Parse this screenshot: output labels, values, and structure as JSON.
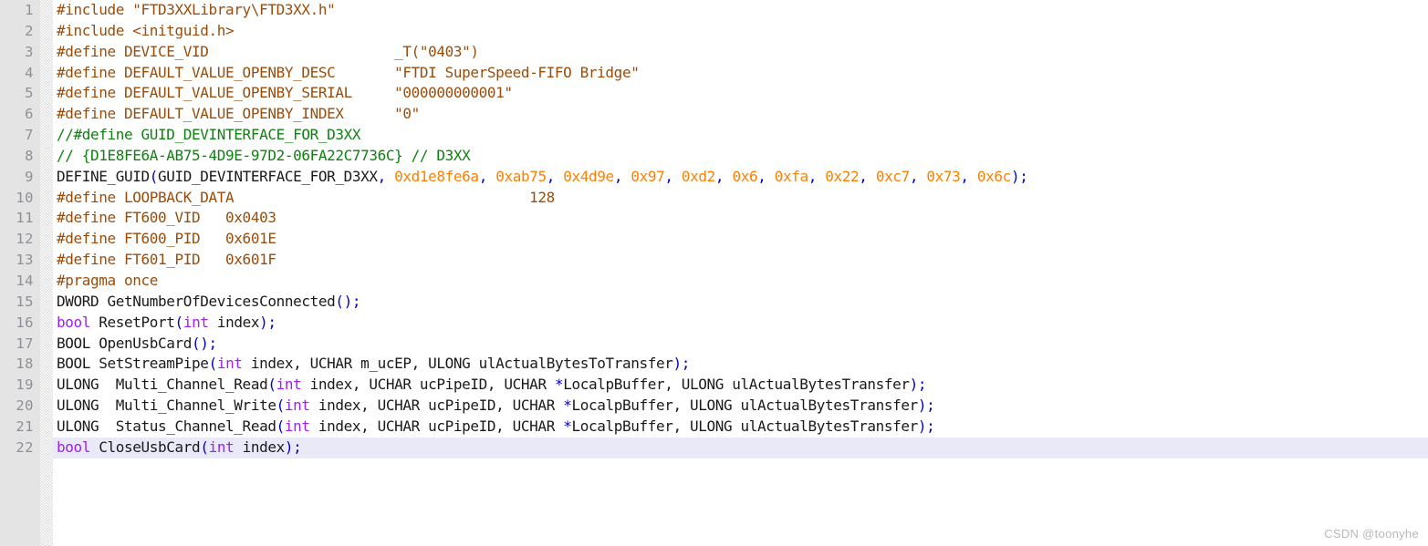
{
  "editor": {
    "title": "C/C++ header source view",
    "language": "C++",
    "total_lines": 22,
    "current_line": 22,
    "colors": {
      "background": "#ffffff",
      "gutter_background": "#e4e4e4",
      "gutter_text": "#8e9099",
      "current_line_highlight": "#e9e9f8",
      "preprocessor": "#9a4d0b",
      "comment": "#108010",
      "keyword": "#a020f0",
      "number": "#ff8000",
      "operator": "#0000c0",
      "plain_text": "#1a1a1a",
      "watermark": "#b8b8b8"
    }
  },
  "gutter": {
    "line_numbers": [
      "1",
      "2",
      "3",
      "4",
      "5",
      "6",
      "7",
      "8",
      "9",
      "10",
      "11",
      "12",
      "13",
      "14",
      "15",
      "16",
      "17",
      "18",
      "19",
      "20",
      "21",
      "22"
    ]
  },
  "code": {
    "lines": [
      {
        "n": 1,
        "highlight": false,
        "tokens": [
          {
            "t": "pre",
            "v": "#include \"FTD3XXLibrary\\FTD3XX.h\""
          }
        ]
      },
      {
        "n": 2,
        "highlight": false,
        "tokens": [
          {
            "t": "pre",
            "v": "#include <initguid.h>"
          }
        ]
      },
      {
        "n": 3,
        "highlight": false,
        "tokens": [
          {
            "t": "pre",
            "v": "#define DEVICE_VID                      _T(\"0403\")"
          }
        ]
      },
      {
        "n": 4,
        "highlight": false,
        "tokens": [
          {
            "t": "pre",
            "v": "#define DEFAULT_VALUE_OPENBY_DESC       \"FTDI SuperSpeed-FIFO Bridge\""
          }
        ]
      },
      {
        "n": 5,
        "highlight": false,
        "tokens": [
          {
            "t": "pre",
            "v": "#define DEFAULT_VALUE_OPENBY_SERIAL     \"000000000001\""
          }
        ]
      },
      {
        "n": 6,
        "highlight": false,
        "tokens": [
          {
            "t": "pre",
            "v": "#define DEFAULT_VALUE_OPENBY_INDEX      \"0\""
          }
        ]
      },
      {
        "n": 7,
        "highlight": false,
        "tokens": [
          {
            "t": "cmt",
            "v": "//#define GUID_DEVINTERFACE_FOR_D3XX"
          }
        ]
      },
      {
        "n": 8,
        "highlight": false,
        "tokens": [
          {
            "t": "cmt",
            "v": "// {D1E8FE6A-AB75-4D9E-97D2-06FA22C7736C} // D3XX"
          }
        ]
      },
      {
        "n": 9,
        "highlight": false,
        "tokens": [
          {
            "t": "txt",
            "v": "DEFINE_GUID"
          },
          {
            "t": "op",
            "v": "("
          },
          {
            "t": "txt",
            "v": "GUID_DEVINTERFACE_FOR_D3XX"
          },
          {
            "t": "op",
            "v": ","
          },
          {
            "t": "txt",
            "v": " "
          },
          {
            "t": "num",
            "v": "0xd1e8fe6a"
          },
          {
            "t": "op",
            "v": ","
          },
          {
            "t": "txt",
            "v": " "
          },
          {
            "t": "num",
            "v": "0xab75"
          },
          {
            "t": "op",
            "v": ","
          },
          {
            "t": "txt",
            "v": " "
          },
          {
            "t": "num",
            "v": "0x4d9e"
          },
          {
            "t": "op",
            "v": ","
          },
          {
            "t": "txt",
            "v": " "
          },
          {
            "t": "num",
            "v": "0x97"
          },
          {
            "t": "op",
            "v": ","
          },
          {
            "t": "txt",
            "v": " "
          },
          {
            "t": "num",
            "v": "0xd2"
          },
          {
            "t": "op",
            "v": ","
          },
          {
            "t": "txt",
            "v": " "
          },
          {
            "t": "num",
            "v": "0x6"
          },
          {
            "t": "op",
            "v": ","
          },
          {
            "t": "txt",
            "v": " "
          },
          {
            "t": "num",
            "v": "0xfa"
          },
          {
            "t": "op",
            "v": ","
          },
          {
            "t": "txt",
            "v": " "
          },
          {
            "t": "num",
            "v": "0x22"
          },
          {
            "t": "op",
            "v": ","
          },
          {
            "t": "txt",
            "v": " "
          },
          {
            "t": "num",
            "v": "0xc7"
          },
          {
            "t": "op",
            "v": ","
          },
          {
            "t": "txt",
            "v": " "
          },
          {
            "t": "num",
            "v": "0x73"
          },
          {
            "t": "op",
            "v": ","
          },
          {
            "t": "txt",
            "v": " "
          },
          {
            "t": "num",
            "v": "0x6c"
          },
          {
            "t": "op",
            "v": ");"
          }
        ]
      },
      {
        "n": 10,
        "highlight": false,
        "tokens": [
          {
            "t": "pre",
            "v": "#define LOOPBACK_DATA                                   128"
          }
        ]
      },
      {
        "n": 11,
        "highlight": false,
        "tokens": [
          {
            "t": "pre",
            "v": "#define FT600_VID   0x0403"
          }
        ]
      },
      {
        "n": 12,
        "highlight": false,
        "tokens": [
          {
            "t": "pre",
            "v": "#define FT600_PID   0x601E"
          }
        ]
      },
      {
        "n": 13,
        "highlight": false,
        "tokens": [
          {
            "t": "pre",
            "v": "#define FT601_PID   0x601F"
          }
        ]
      },
      {
        "n": 14,
        "highlight": false,
        "tokens": [
          {
            "t": "pre",
            "v": "#pragma once"
          }
        ]
      },
      {
        "n": 15,
        "highlight": false,
        "tokens": [
          {
            "t": "txt",
            "v": "DWORD GetNumberOfDevicesConnected"
          },
          {
            "t": "op",
            "v": "()"
          },
          {
            "t": "op",
            "v": ";"
          }
        ]
      },
      {
        "n": 16,
        "highlight": false,
        "tokens": [
          {
            "t": "kw",
            "v": "bool"
          },
          {
            "t": "txt",
            "v": " ResetPort"
          },
          {
            "t": "op",
            "v": "("
          },
          {
            "t": "kw",
            "v": "int"
          },
          {
            "t": "txt",
            "v": " index"
          },
          {
            "t": "op",
            "v": ");"
          }
        ]
      },
      {
        "n": 17,
        "highlight": false,
        "tokens": [
          {
            "t": "txt",
            "v": "BOOL OpenUsbCard"
          },
          {
            "t": "op",
            "v": "();"
          }
        ]
      },
      {
        "n": 18,
        "highlight": false,
        "tokens": [
          {
            "t": "txt",
            "v": "BOOL SetStreamPipe"
          },
          {
            "t": "op",
            "v": "("
          },
          {
            "t": "kw",
            "v": "int"
          },
          {
            "t": "txt",
            "v": " index, UCHAR m_ucEP, ULONG ulActualBytesToTransfer"
          },
          {
            "t": "op",
            "v": ");"
          }
        ]
      },
      {
        "n": 19,
        "highlight": false,
        "tokens": [
          {
            "t": "txt",
            "v": "ULONG  Multi_Channel_Read"
          },
          {
            "t": "op",
            "v": "("
          },
          {
            "t": "kw",
            "v": "int"
          },
          {
            "t": "txt",
            "v": " index, UCHAR ucPipeID, UCHAR "
          },
          {
            "t": "op",
            "v": "*"
          },
          {
            "t": "txt",
            "v": "LocalpBuffer, ULONG ulActualBytesTransfer"
          },
          {
            "t": "op",
            "v": ");"
          }
        ]
      },
      {
        "n": 20,
        "highlight": false,
        "tokens": [
          {
            "t": "txt",
            "v": "ULONG  Multi_Channel_Write"
          },
          {
            "t": "op",
            "v": "("
          },
          {
            "t": "kw",
            "v": "int"
          },
          {
            "t": "txt",
            "v": " index, UCHAR ucPipeID, UCHAR "
          },
          {
            "t": "op",
            "v": "*"
          },
          {
            "t": "txt",
            "v": "LocalpBuffer, ULONG ulActualBytesTransfer"
          },
          {
            "t": "op",
            "v": ");"
          }
        ]
      },
      {
        "n": 21,
        "highlight": false,
        "tokens": [
          {
            "t": "txt",
            "v": "ULONG  Status_Channel_Read"
          },
          {
            "t": "op",
            "v": "("
          },
          {
            "t": "kw",
            "v": "int"
          },
          {
            "t": "txt",
            "v": " index, UCHAR ucPipeID, UCHAR "
          },
          {
            "t": "op",
            "v": "*"
          },
          {
            "t": "txt",
            "v": "LocalpBuffer, ULONG ulActualBytesTransfer"
          },
          {
            "t": "op",
            "v": ");"
          }
        ]
      },
      {
        "n": 22,
        "highlight": true,
        "tokens": [
          {
            "t": "kw",
            "v": "bool"
          },
          {
            "t": "txt",
            "v": " CloseUsbCard"
          },
          {
            "t": "op",
            "v": "("
          },
          {
            "t": "kw",
            "v": "int"
          },
          {
            "t": "txt",
            "v": " index"
          },
          {
            "t": "op",
            "v": ");"
          }
        ]
      }
    ]
  },
  "watermark": {
    "text": "CSDN @toonyhe"
  }
}
